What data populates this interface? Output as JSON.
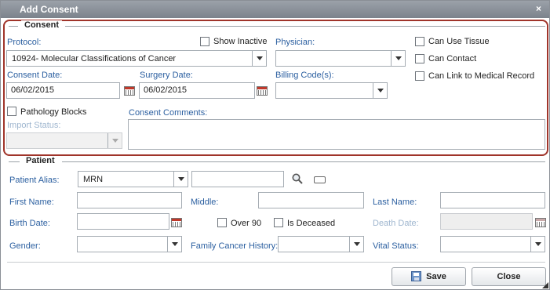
{
  "dialog": {
    "title": "Add Consent",
    "close_glyph": "×"
  },
  "consent": {
    "legend": "Consent",
    "protocol_label": "Protocol:",
    "protocol_value": "10924- Molecular Classifications of Cancer",
    "show_inactive_label": "Show Inactive",
    "physician_label": "Physician:",
    "physician_value": "",
    "can_use_tissue_label": "Can Use Tissue",
    "can_contact_label": "Can Contact",
    "can_link_label": "Can Link to Medical Record",
    "consent_date_label": "Consent Date:",
    "consent_date_value": "06/02/2015",
    "surgery_date_label": "Surgery Date:",
    "surgery_date_value": "06/02/2015",
    "billing_codes_label": "Billing Code(s):",
    "billing_codes_value": "",
    "pathology_blocks_label": "Pathology Blocks",
    "import_status_label": "Import Status:",
    "import_status_value": "",
    "consent_comments_label": "Consent Comments:",
    "consent_comments_value": ""
  },
  "patient": {
    "legend": "Patient",
    "alias_label": "Patient Alias:",
    "alias_type_value": "MRN",
    "alias_value": "",
    "first_name_label": "First Name:",
    "middle_label": "Middle:",
    "last_name_label": "Last Name:",
    "birth_date_label": "Birth Date:",
    "over_90_label": "Over 90",
    "is_deceased_label": "Is Deceased",
    "death_date_label": "Death Date:",
    "gender_label": "Gender:",
    "family_cancer_history_label": "Family Cancer History:",
    "vital_status_label": "Vital Status:"
  },
  "actions": {
    "save_label": "Save",
    "close_label": "Close"
  },
  "icons": [
    "close-icon",
    "calendar-icon",
    "search-icon",
    "card-icon",
    "save-icon",
    "chevron-down-icon",
    "resize-grip-icon"
  ],
  "colors": {
    "titlebar": "#8a9098",
    "consent_border": "#a0342a",
    "label_blue": "#2b5fa0",
    "disabled_label": "#9fb6cf"
  }
}
